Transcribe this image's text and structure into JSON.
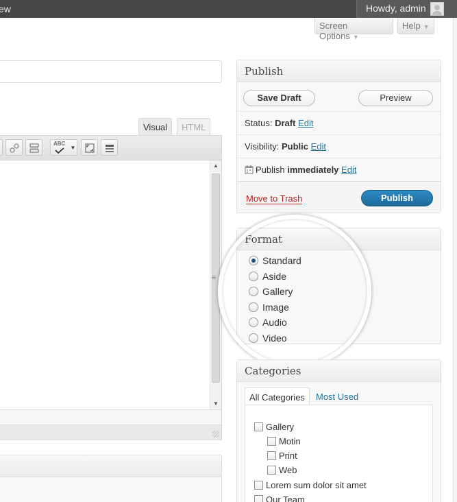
{
  "admin_bar": {
    "left_fragment": "ew",
    "howdy": "Howdy, admin"
  },
  "screen_meta": {
    "screen_options": "Screen Options",
    "help": "Help"
  },
  "editor": {
    "tab_visual": "Visual",
    "tab_html": "HTML",
    "spellcheck_label": "ABC"
  },
  "publish": {
    "title": "Publish",
    "save_draft": "Save Draft",
    "preview": "Preview",
    "status_label": "Status:",
    "status_value": "Draft",
    "status_edit": "Edit",
    "visibility_label": "Visibility:",
    "visibility_value": "Public",
    "visibility_edit": "Edit",
    "publish_label": "Publish",
    "publish_value": "immediately",
    "publish_edit": "Edit",
    "move_to_trash": "Move to Trash",
    "publish_button": "Publish"
  },
  "format": {
    "title": "Format",
    "options": [
      {
        "label": "Standard",
        "checked": true
      },
      {
        "label": "Aside",
        "checked": false
      },
      {
        "label": "Gallery",
        "checked": false
      },
      {
        "label": "Image",
        "checked": false
      },
      {
        "label": "Audio",
        "checked": false
      },
      {
        "label": "Video",
        "checked": false
      }
    ]
  },
  "categories": {
    "title": "Categories",
    "tab_all": "All Categories",
    "tab_most_used": "Most Used",
    "items": [
      {
        "label": "Gallery",
        "level": 0,
        "checked": false
      },
      {
        "label": "Motin",
        "level": 1,
        "checked": false
      },
      {
        "label": "Print",
        "level": 1,
        "checked": false
      },
      {
        "label": "Web",
        "level": 1,
        "checked": false
      },
      {
        "label": "Lorem sum dolor sit amet",
        "level": 0,
        "checked": false
      },
      {
        "label": "Our Team",
        "level": 0,
        "checked": false
      }
    ]
  },
  "colors": {
    "admin_bar": "#464646",
    "link": "#21759b",
    "primary_button": "#2e8bc4",
    "trash": "#b81e1e"
  }
}
